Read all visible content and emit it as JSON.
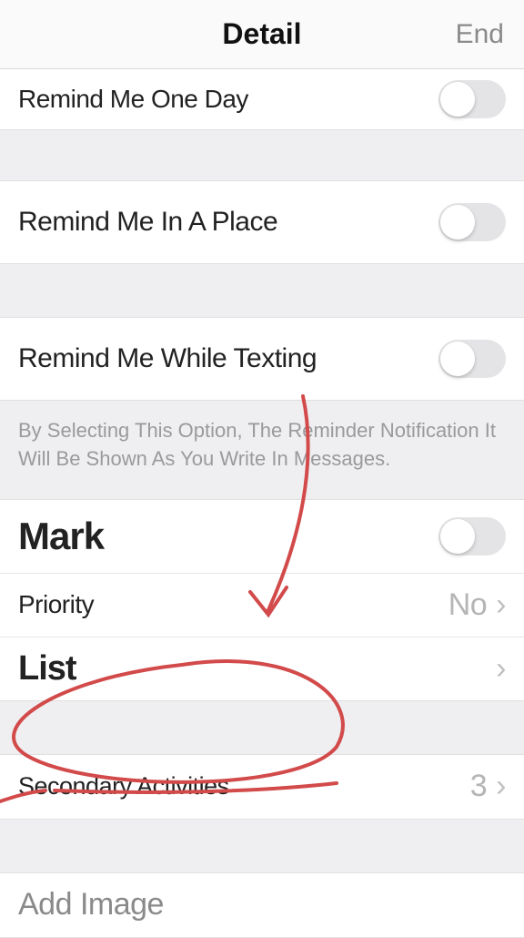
{
  "header": {
    "title": "Detail",
    "end": "End"
  },
  "rows": {
    "remind_day": "Remind Me One Day",
    "remind_place": "Remind Me In A Place",
    "remind_texting": "Remind Me While Texting",
    "texting_note": "By Selecting This Option, The Reminder Notification It Will Be Shown As You Write In Messages.",
    "mark": "Mark",
    "priority_label": "Priority",
    "priority_value": "No",
    "list_label": "List",
    "secondary_label": "Secondary Activities",
    "secondary_value": "3",
    "add_image": "Add Image"
  }
}
